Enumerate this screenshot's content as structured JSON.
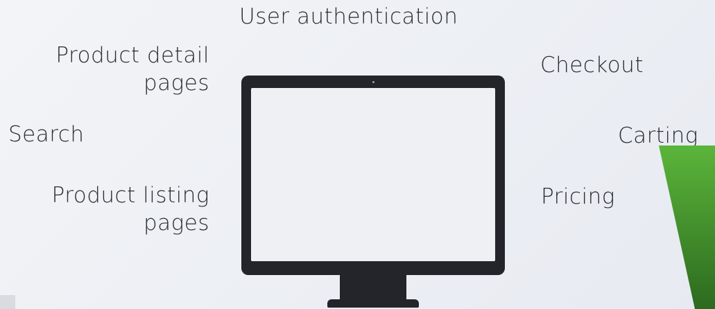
{
  "labels": {
    "user_authentication": "User authentication",
    "product_detail_line1": "Product detail",
    "product_detail_line2": "pages",
    "search": "Search",
    "product_listing_line1": "Product listing",
    "product_listing_line2": "pages",
    "checkout": "Checkout",
    "carting": "Carting",
    "pricing": "Pricing"
  },
  "colors": {
    "text": "#2a2d33",
    "monitor": "#23252a",
    "screen": "#eef0f4",
    "accent_green_top": "#5bb53a",
    "accent_green_bottom": "#2c6a1f"
  },
  "icons": {
    "center": "monitor-icon"
  }
}
